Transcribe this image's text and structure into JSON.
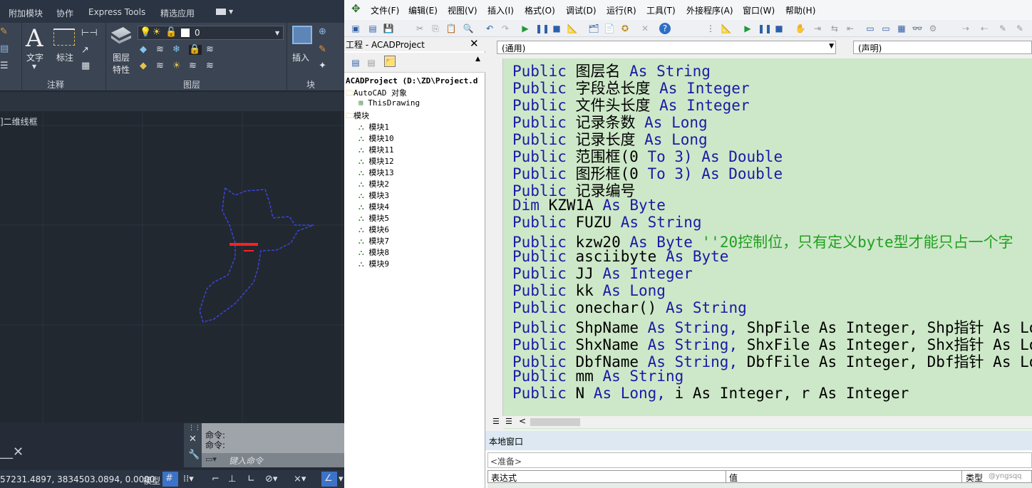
{
  "acad": {
    "tabs": [
      "附加模块",
      "协作",
      "Express Tools",
      "精选应用"
    ],
    "panels": {
      "annotation": "注释",
      "layers": "图层",
      "block": "块"
    },
    "buttons": {
      "text": "文字",
      "dim": "标注",
      "layer_props": "图层",
      "layer_props2": "特性",
      "insert": "插入"
    },
    "layer_value": "0",
    "viewport_label": "]二维线框",
    "cmd": {
      "line1": "命令:",
      "line2": "命令:",
      "placeholder": "键入命令"
    },
    "status": {
      "coords": "57231.4897, 3834503.0894, 0.0000",
      "model": "模型"
    }
  },
  "vbe": {
    "menus": [
      "文件(F)",
      "编辑(E)",
      "视图(V)",
      "插入(I)",
      "格式(O)",
      "调试(D)",
      "运行(R)",
      "工具(T)",
      "外接程序(A)",
      "窗口(W)",
      "帮助(H)"
    ],
    "project": {
      "title": "工程 - ACADProject",
      "root": "ACADProject (D:\\ZD\\Project.d",
      "folder1": "AutoCAD 对象",
      "item1": "ThisDrawing",
      "folder2": "模块",
      "modules": [
        "模块1",
        "模块10",
        "模块11",
        "模块12",
        "模块13",
        "模块2",
        "模块3",
        "模块4",
        "模块5",
        "模块6",
        "模块7",
        "模块8",
        "模块9"
      ]
    },
    "combo_left": "(通用)",
    "combo_right": "(声明)",
    "code_lines": [
      {
        "a": "Public",
        "b": " 图层名 ",
        "c": "As String",
        "d": ""
      },
      {
        "a": "Public",
        "b": " 字段总长度     ",
        "c": "As Integer",
        "d": ""
      },
      {
        "a": "Public",
        "b": " 文件头长度     ",
        "c": "As Integer",
        "d": ""
      },
      {
        "a": "Public",
        "b": " 记录条数       ",
        "c": "As Long",
        "d": ""
      },
      {
        "a": "Public",
        "b": " 记录长度       ",
        "c": "As Long",
        "d": ""
      },
      {
        "a": "Public",
        "b": " 范围框(0 ",
        "c": "To 3) As Double",
        "d": ""
      },
      {
        "a": "Public",
        "b": " 图形框(0 ",
        "c": "To 3) As Double",
        "d": ""
      },
      {
        "a": "Public",
        "b": " 记录编号",
        "c": "",
        "d": ""
      },
      {
        "a": "Dim",
        "b": " KZW1A ",
        "c": "As Byte",
        "d": ""
      },
      {
        "a": "Public",
        "b": " FUZU ",
        "c": "As String",
        "d": ""
      },
      {
        "a": "Public",
        "b": " kzw20 ",
        "c": "As Byte",
        "d": " ''20控制位，只有定义byte型才能只占一个字"
      },
      {
        "a": "Public",
        "b": " asciibyte ",
        "c": "As Byte",
        "d": ""
      },
      {
        "a": "Public",
        "b": " JJ ",
        "c": "As Integer",
        "d": ""
      },
      {
        "a": "Public",
        "b": " kk ",
        "c": "As Long",
        "d": ""
      },
      {
        "a": "Public",
        "b": " onechar() ",
        "c": "As String",
        "d": ""
      },
      {
        "a": "Public",
        "b": " ShpName ",
        "c": "As String,",
        "d": " ShpFile As Integer, Shp指针 As Long"
      },
      {
        "a": "Public",
        "b": " ShxName ",
        "c": "As String,",
        "d": " ShxFile As Integer, Shx指针 As Long"
      },
      {
        "a": "Public",
        "b": " DbfName ",
        "c": "As String,",
        "d": " DbfFile As Integer, Dbf指针 As Long"
      },
      {
        "a": "Public",
        "b": " mm ",
        "c": "As String",
        "d": ""
      },
      {
        "a": "Public",
        "b": " N ",
        "c": "As Long,",
        "d": " i As Integer, r As Integer"
      }
    ],
    "locals": {
      "title": "本地窗口",
      "status": "<准备>",
      "col1": "表达式",
      "col2": "值",
      "col3": "类型",
      "watermark": "@yngsqq"
    }
  }
}
